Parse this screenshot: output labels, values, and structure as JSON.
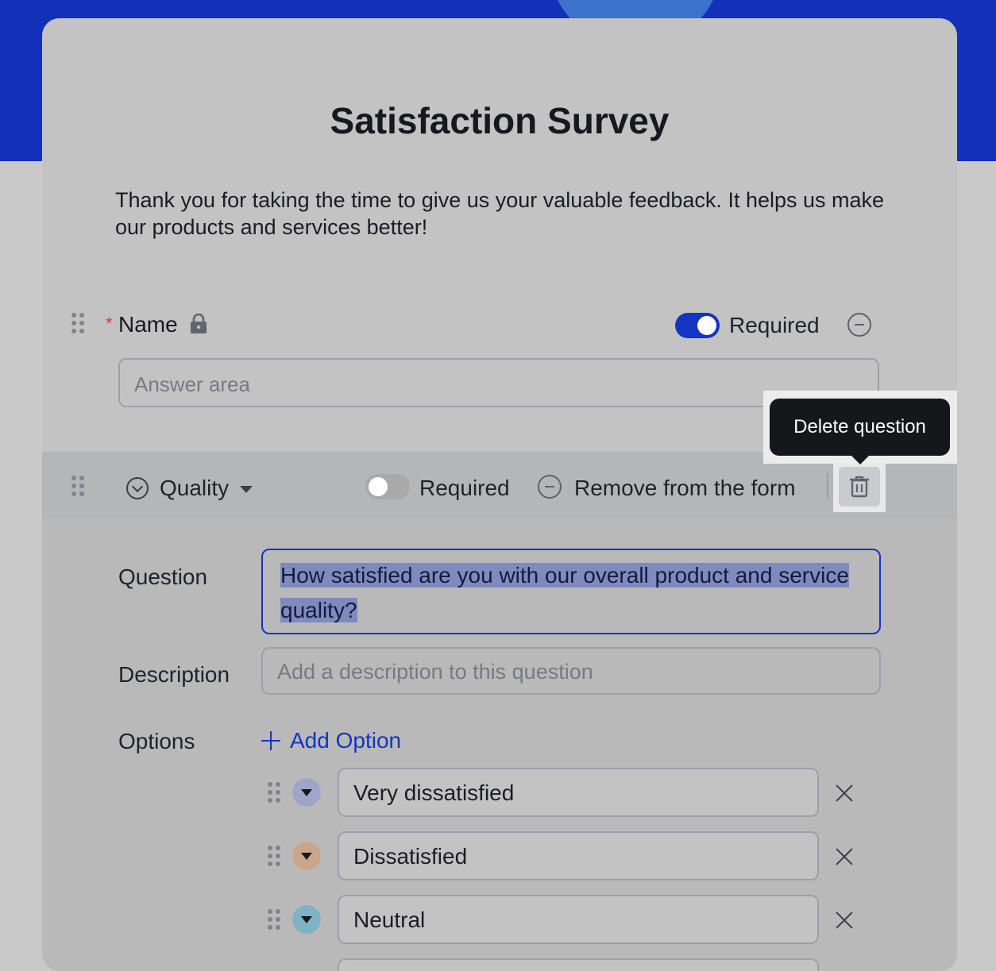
{
  "survey": {
    "title": "Satisfaction Survey",
    "description": "Thank you for taking the time to give us your valuable feedback. It helps us make our products and services better!"
  },
  "name_question": {
    "required_marker": "*",
    "label": "Name",
    "required_label": "Required",
    "required_on": true,
    "answer_placeholder": "Answer area"
  },
  "quality_question": {
    "type_label": "Quality",
    "required_label": "Required",
    "required_on": false,
    "remove_label": "Remove from the form",
    "tooltip": "Delete question",
    "question_label": "Question",
    "question_text": "How satisfied are you with our overall product and service quality?",
    "description_label": "Description",
    "description_placeholder": "Add a description to this question",
    "options_label": "Options",
    "add_option_label": "Add Option",
    "options": [
      {
        "label": "Very dissatisfied",
        "color": "#9ea6c8"
      },
      {
        "label": "Dissatisfied",
        "color": "#c9a68a"
      },
      {
        "label": "Neutral",
        "color": "#7fb2c4"
      }
    ]
  },
  "colors": {
    "accent": "#1435c2",
    "header_band": "#1330b8",
    "required_star": "#d83b3b"
  }
}
